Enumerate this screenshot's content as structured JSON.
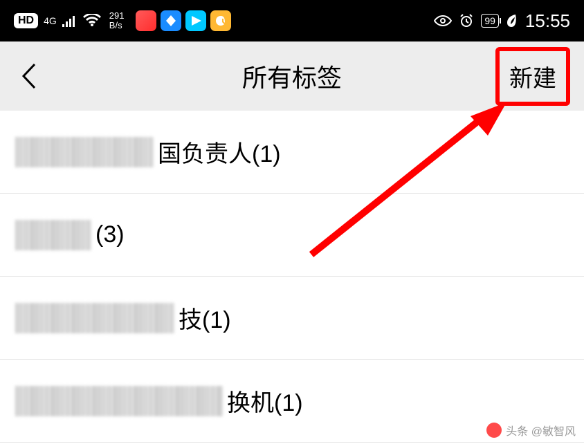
{
  "status": {
    "hd": "HD",
    "network": "4G",
    "speed_top": "291",
    "speed_bottom": "B/s",
    "battery": "99",
    "time": "15:55"
  },
  "header": {
    "title": "所有标签",
    "new_label": "新建"
  },
  "list": {
    "items": [
      {
        "suffix": "国负责人(1)",
        "blur_width": 200
      },
      {
        "suffix": "(3)",
        "blur_width": 110
      },
      {
        "suffix": "技(1)",
        "blur_width": 230
      },
      {
        "suffix": "换机(1)",
        "blur_width": 300
      }
    ]
  },
  "watermark": {
    "text": "头条 @敏智风"
  }
}
